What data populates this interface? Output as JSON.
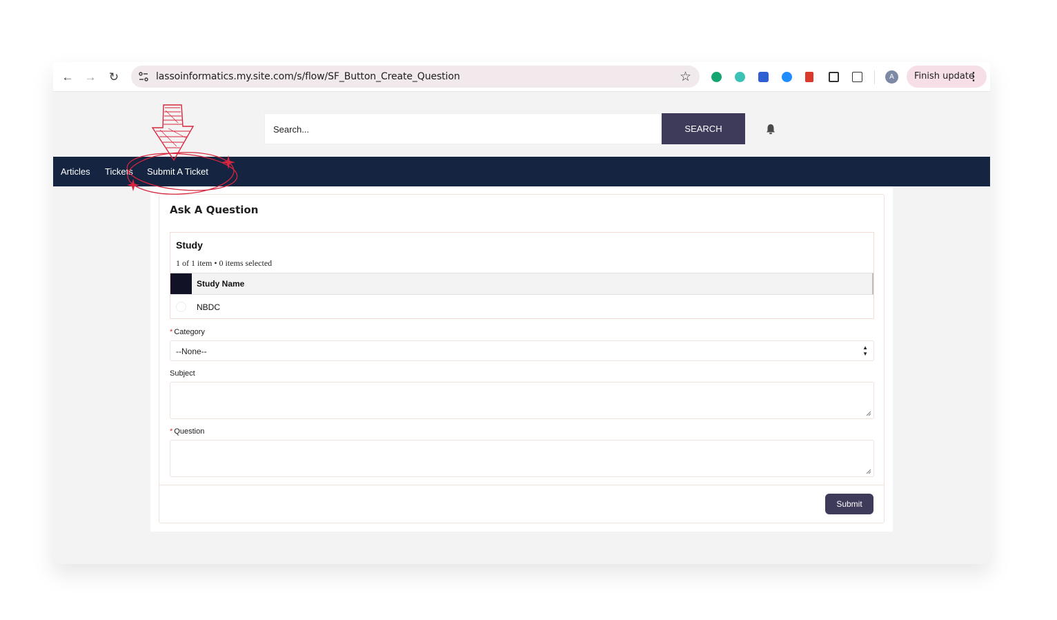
{
  "browser": {
    "url": "lassoinformatics.my.site.com/s/flow/SF_Button_Create_Question",
    "finish_update_label": "Finish update",
    "profile_initial": "A",
    "extensions": [
      "grammarly-icon",
      "m-extension-icon",
      "chart-extension-icon",
      "shazam-icon",
      "bookmark-extension-icon",
      "picture-in-picture-icon",
      "puzzle-icon"
    ]
  },
  "header": {
    "search_placeholder": "Search...",
    "search_button": "SEARCH"
  },
  "nav": {
    "items": [
      "Articles",
      "Tickets",
      "Submit A Ticket"
    ]
  },
  "form": {
    "title": "Ask A Question",
    "study": {
      "title": "Study",
      "meta": "1 of 1 item • 0 items selected",
      "column_header": "Study Name",
      "rows": [
        "NBDC"
      ]
    },
    "category_label": "Category",
    "category_value": "--None--",
    "subject_label": "Subject",
    "question_label": "Question",
    "required_mark": "*",
    "submit_label": "Submit"
  },
  "colors": {
    "nav_bg": "#142441",
    "button_bg": "#3e3a5a",
    "annotation": "#d7263d"
  }
}
